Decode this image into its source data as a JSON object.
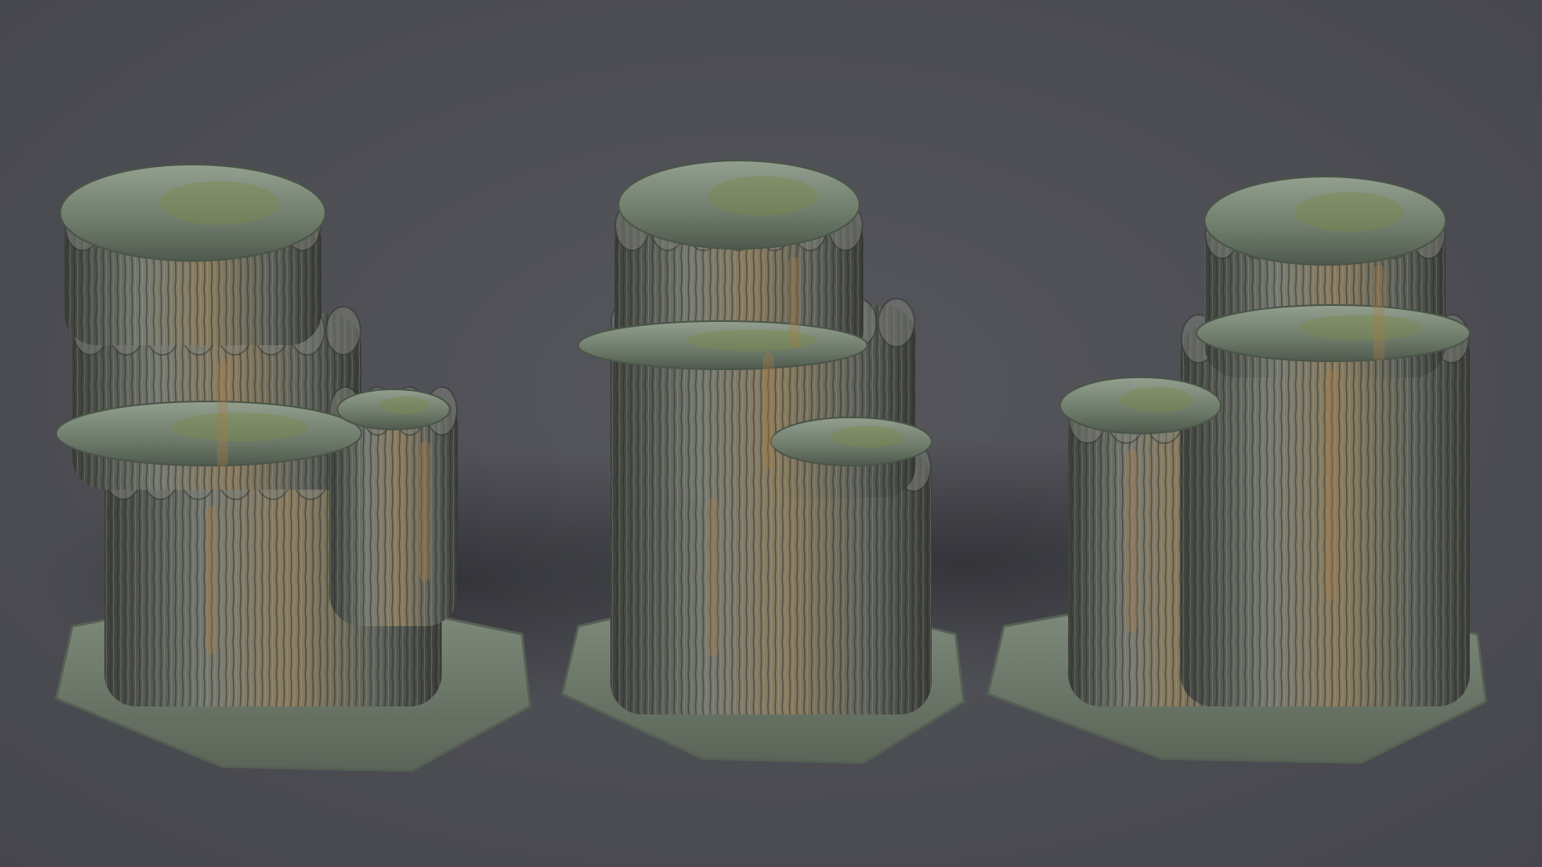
{
  "scene": {
    "background_color": "#4b4c52",
    "shadow_color": "#2f3036",
    "rock_palette": {
      "cap_light": "#8c9a8c",
      "cap_mid": "#6f7d6e",
      "moss": "#7a8a4c",
      "column_light": "#7d8078",
      "column_mid": "#5b5e57",
      "column_dark": "#383a36",
      "rust": "#a77a45",
      "base_light": "#8b968a",
      "base_dark": "#566054"
    },
    "objects": [
      {
        "name": "stalagmite-rock-left",
        "label": ""
      },
      {
        "name": "stalagmite-rock-center",
        "label": ""
      },
      {
        "name": "stalagmite-rock-right",
        "label": ""
      }
    ]
  }
}
